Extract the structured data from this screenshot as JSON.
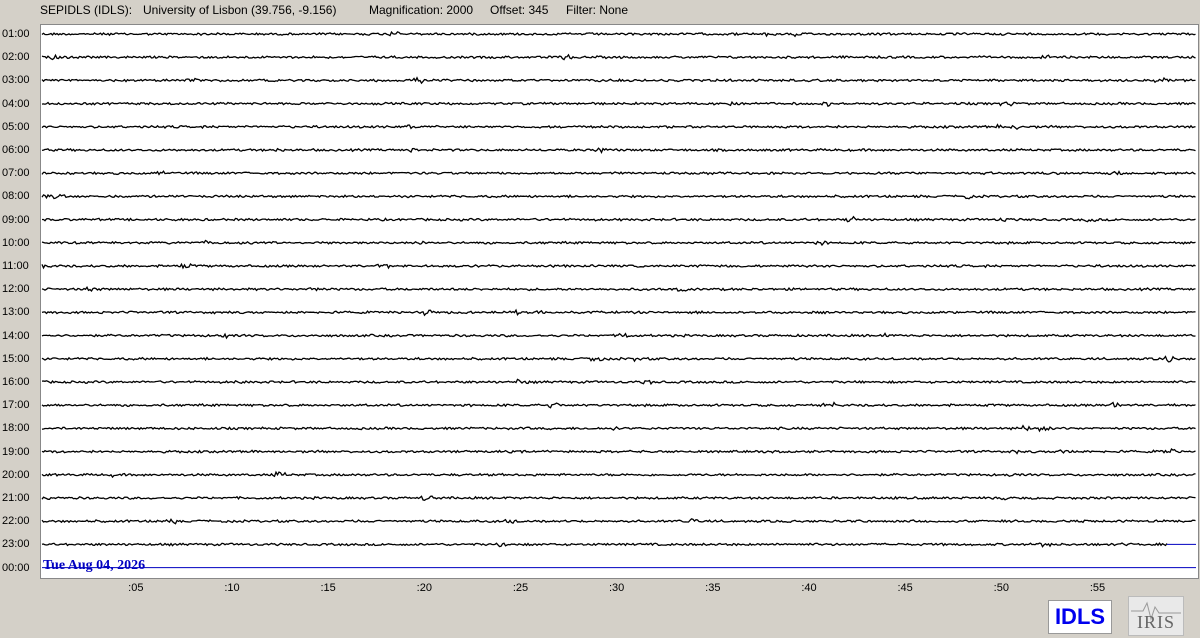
{
  "header": {
    "station": "SEPIDLS (IDLS):",
    "location": "University of Lisbon (39.756, -9.156)",
    "magnification": "Magnification: 2000",
    "offset": "Offset: 345",
    "filter": "Filter: None"
  },
  "hours": [
    "01:00",
    "02:00",
    "03:00",
    "04:00",
    "05:00",
    "06:00",
    "07:00",
    "08:00",
    "09:00",
    "10:00",
    "11:00",
    "12:00",
    "13:00",
    "14:00",
    "15:00",
    "16:00",
    "17:00",
    "18:00",
    "19:00",
    "20:00",
    "21:00",
    "22:00",
    "23:00",
    "00:00"
  ],
  "minute_ticks": [
    ":05",
    ":10",
    ":15",
    ":20",
    ":25",
    ":30",
    ":35",
    ":40",
    ":45",
    ":50",
    ":55"
  ],
  "date": "Tue Aug 04, 2026",
  "logos": {
    "idls": "IDLS",
    "iris": "IRIS"
  },
  "colors": {
    "trace": "#000000",
    "current": "#0000c0",
    "background": "#d4d0c8"
  }
}
